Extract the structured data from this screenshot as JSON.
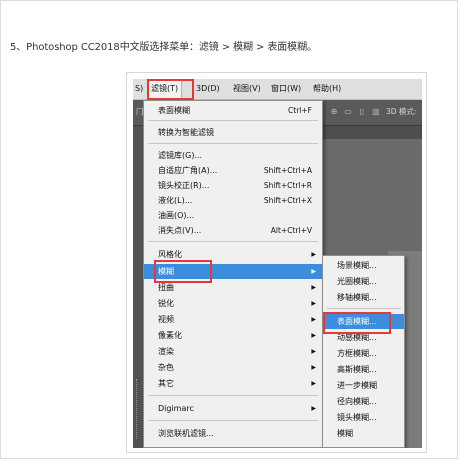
{
  "instruction": "5、Photoshop CC2018中文版选择菜单：滤镜 > 模糊 > 表面模糊。",
  "menubar": {
    "left_fragment": "S)",
    "filter": "滤镜(T)",
    "three_d": "3D(D)",
    "view": "视图(V)",
    "window": "窗口(W)",
    "help": "帮助(H)"
  },
  "options_bar": {
    "mode_label": "3D 模式:",
    "left_fragment": "门"
  },
  "filter_menu": {
    "last_filter": "表面模糊",
    "last_filter_shortcut": "Ctrl+F",
    "convert_smart": "转换为智能滤镜",
    "gallery": "滤镜库(G)...",
    "adaptive_wide": "自适应广角(A)...",
    "adaptive_wide_shortcut": "Shift+Ctrl+A",
    "lens_correction": "镜头校正(R)...",
    "lens_correction_shortcut": "Shift+Ctrl+R",
    "liquify": "液化(L)...",
    "liquify_shortcut": "Shift+Ctrl+X",
    "oil_paint": "油画(O)...",
    "vanishing_point": "消失点(V)...",
    "vanishing_point_shortcut": "Alt+Ctrl+V",
    "stylize": "风格化",
    "blur": "模糊",
    "distort": "扭曲",
    "sharpen": "锐化",
    "video": "视频",
    "pixelate": "像素化",
    "render": "渲染",
    "noise": "杂色",
    "other": "其它",
    "digimarc": "Digimarc",
    "browse_online": "浏览联机滤镜..."
  },
  "blur_submenu": {
    "field_blur": "场景模糊...",
    "iris_blur": "光圈模糊...",
    "tilt_shift": "移轴模糊...",
    "surface_blur": "表面模糊...",
    "motion_blur": "动感模糊...",
    "box_blur": "方框模糊...",
    "gaussian_blur": "高斯模糊...",
    "further_blur": "进一步模糊",
    "radial_blur": "径向模糊...",
    "lens_blur": "镜头模糊...",
    "blur": "模糊"
  },
  "colors": {
    "highlight": "#3b8ede",
    "annotation_red": "#e53935"
  }
}
